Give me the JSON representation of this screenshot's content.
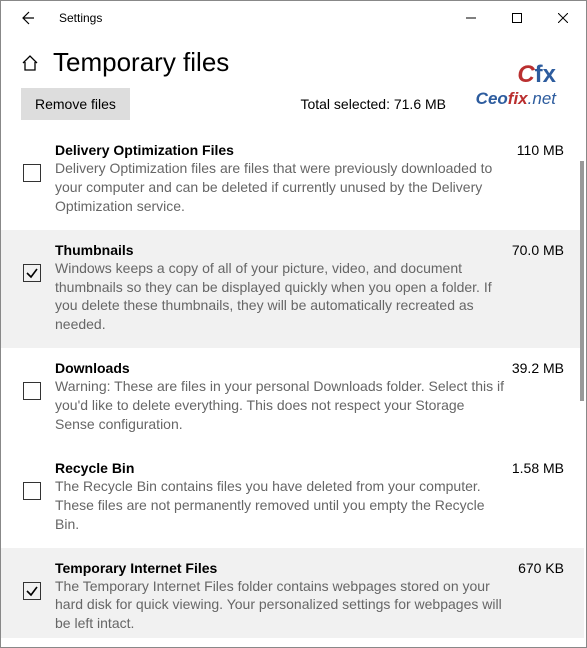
{
  "window": {
    "title": "Settings"
  },
  "page": {
    "title": "Temporary files"
  },
  "actions": {
    "remove_label": "Remove files"
  },
  "summary": {
    "total_label": "Total selected: 71.6 MB"
  },
  "logo": {
    "top": "Cfx",
    "url_ceo": "Ceo",
    "url_fix": "fix",
    "url_net": ".net"
  },
  "items": [
    {
      "title": "Delivery Optimization Files",
      "size": "110 MB",
      "desc": "Delivery Optimization files are files that were previously downloaded to your computer and can be deleted if currently unused by the Delivery Optimization service.",
      "checked": false
    },
    {
      "title": "Thumbnails",
      "size": "70.0 MB",
      "desc": "Windows keeps a copy of all of your picture, video, and document thumbnails so they can be displayed quickly when you open a folder. If you delete these thumbnails, they will be automatically recreated as needed.",
      "checked": true
    },
    {
      "title": "Downloads",
      "size": "39.2 MB",
      "desc": "Warning: These are files in your personal Downloads folder. Select this if you'd like to delete everything. This does not respect your Storage Sense configuration.",
      "checked": false
    },
    {
      "title": "Recycle Bin",
      "size": "1.58 MB",
      "desc": "The Recycle Bin contains files you have deleted from your computer. These files are not permanently removed until you empty the Recycle Bin.",
      "checked": false
    },
    {
      "title": "Temporary Internet Files",
      "size": "670 KB",
      "desc": "The Temporary Internet Files folder contains webpages stored on your hard disk for quick viewing. Your personalized settings for webpages will be left intact.",
      "checked": true
    }
  ]
}
